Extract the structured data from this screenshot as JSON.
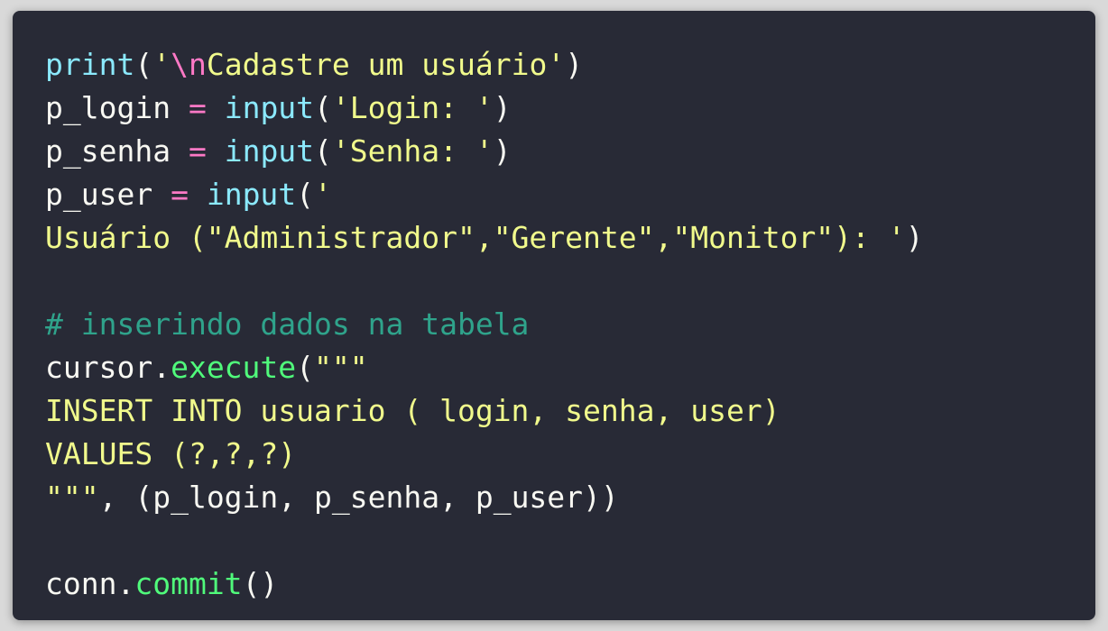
{
  "code_lines": [
    {
      "tokens": [
        {
          "type": "fn-builtin",
          "text": "print"
        },
        {
          "type": "plain",
          "text": "("
        },
        {
          "type": "string",
          "text": "'"
        },
        {
          "type": "escape",
          "text": "\\n"
        },
        {
          "type": "string",
          "text": "Cadastre um usuário'"
        },
        {
          "type": "plain",
          "text": ")"
        }
      ]
    },
    {
      "tokens": [
        {
          "type": "plain",
          "text": "p_login "
        },
        {
          "type": "operator",
          "text": "="
        },
        {
          "type": "plain",
          "text": " "
        },
        {
          "type": "fn-builtin",
          "text": "input"
        },
        {
          "type": "plain",
          "text": "("
        },
        {
          "type": "string",
          "text": "'Login: '"
        },
        {
          "type": "plain",
          "text": ")"
        }
      ]
    },
    {
      "tokens": [
        {
          "type": "plain",
          "text": "p_senha "
        },
        {
          "type": "operator",
          "text": "="
        },
        {
          "type": "plain",
          "text": " "
        },
        {
          "type": "fn-builtin",
          "text": "input"
        },
        {
          "type": "plain",
          "text": "("
        },
        {
          "type": "string",
          "text": "'Senha: '"
        },
        {
          "type": "plain",
          "text": ")"
        }
      ]
    },
    {
      "tokens": [
        {
          "type": "plain",
          "text": "p_user "
        },
        {
          "type": "operator",
          "text": "="
        },
        {
          "type": "plain",
          "text": " "
        },
        {
          "type": "fn-builtin",
          "text": "input"
        },
        {
          "type": "plain",
          "text": "("
        },
        {
          "type": "string",
          "text": "'"
        }
      ]
    },
    {
      "tokens": [
        {
          "type": "string",
          "text": "Usuário (\"Administrador\",\"Gerente\",\"Monitor\"): '"
        },
        {
          "type": "plain",
          "text": ")"
        }
      ]
    },
    {
      "tokens": []
    },
    {
      "tokens": [
        {
          "type": "comment",
          "text": "# inserindo dados na tabela"
        }
      ]
    },
    {
      "tokens": [
        {
          "type": "plain",
          "text": "cursor."
        },
        {
          "type": "fn-method",
          "text": "execute"
        },
        {
          "type": "plain",
          "text": "("
        },
        {
          "type": "string",
          "text": "\"\"\""
        }
      ]
    },
    {
      "tokens": [
        {
          "type": "string",
          "text": "INSERT INTO usuario ( login, senha, user)"
        }
      ]
    },
    {
      "tokens": [
        {
          "type": "string",
          "text": "VALUES (?,?,?)"
        }
      ]
    },
    {
      "tokens": [
        {
          "type": "string",
          "text": "\"\"\""
        },
        {
          "type": "plain",
          "text": ", (p_login, p_senha, p_user))"
        }
      ]
    },
    {
      "tokens": []
    },
    {
      "tokens": [
        {
          "type": "plain",
          "text": "conn."
        },
        {
          "type": "fn-method",
          "text": "commit"
        },
        {
          "type": "plain",
          "text": "()"
        }
      ]
    }
  ],
  "colors": {
    "background": "#282a36",
    "plain": "#f8f8f2",
    "builtin_function": "#8be9fd",
    "method": "#50fa7b",
    "string": "#f1fa8c",
    "escape_and_operator": "#ff79c6",
    "comment": "#2fa38b"
  }
}
